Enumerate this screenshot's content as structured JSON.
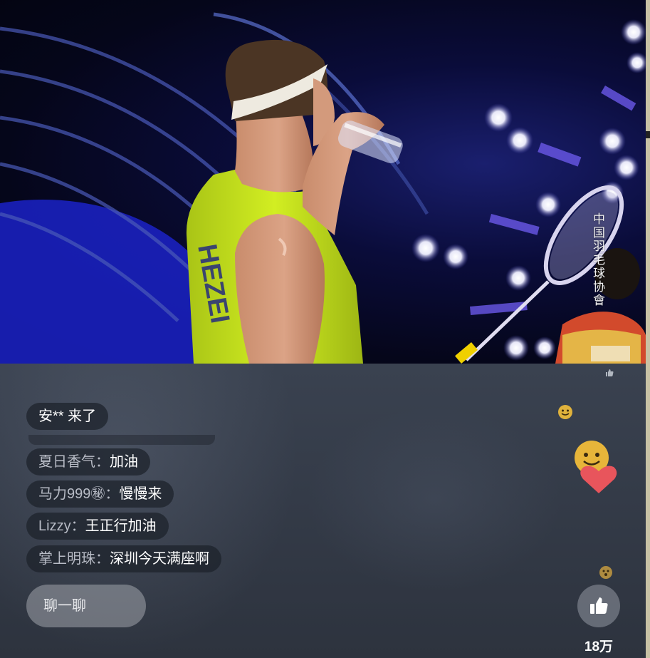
{
  "video": {
    "watermark": "中国羽毛球协會",
    "jersey_text": "HEZEI"
  },
  "chat": {
    "join_notice": "安** 来了",
    "messages": [
      {
        "nick": "夏日香气：",
        "text": "加油"
      },
      {
        "nick": "马力999㊙：",
        "text": "慢慢来"
      },
      {
        "nick": "Lizzy：",
        "text": "王正行加油"
      },
      {
        "nick": "掌上明珠：",
        "text": "深圳今天满座啊"
      }
    ],
    "input_placeholder": "聊一聊"
  },
  "like": {
    "count": "18万",
    "icon": "thumbs-up-icon"
  },
  "colors": {
    "jersey": "#c8e61a",
    "heart": "#e8555c",
    "panel": "#343b48"
  }
}
